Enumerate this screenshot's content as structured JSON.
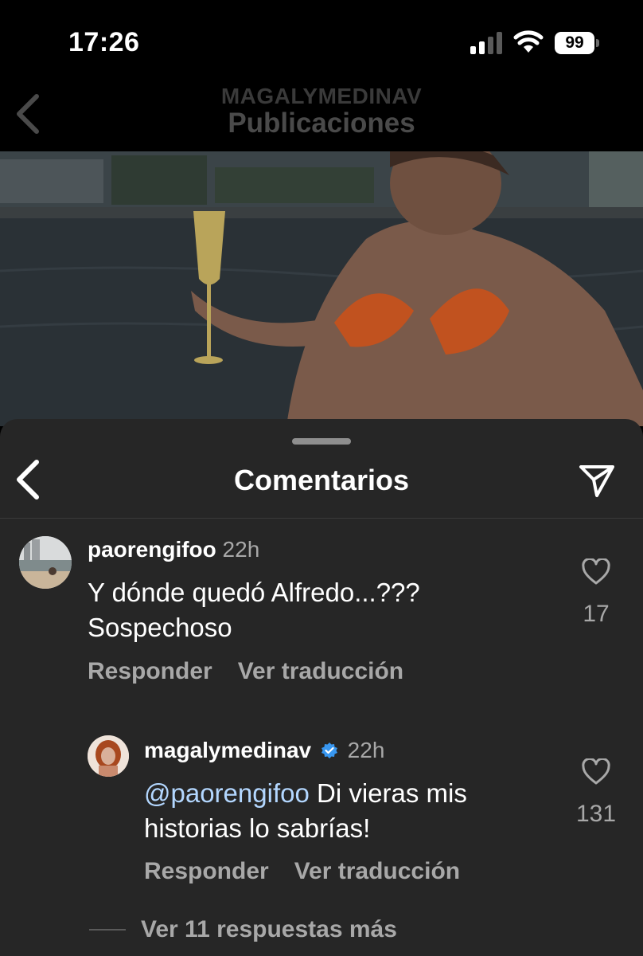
{
  "status_bar": {
    "time": "17:26",
    "battery": "99"
  },
  "header": {
    "username": "MAGALYMEDINAV",
    "title": "Publicaciones"
  },
  "comments_sheet": {
    "title": "Comentarios",
    "comments": [
      {
        "username": "paorengifoo",
        "time": "22h",
        "text_line1": "Y dónde quedó Alfredo...???",
        "text_line2": "Sospechoso",
        "likes": "17",
        "reply_label": "Responder",
        "translate_label": "Ver traducción"
      },
      {
        "username": "magalymedinav",
        "verified": true,
        "time": "22h",
        "mention": "@paorengifoo",
        "text_line1": "Di vieras mis",
        "text_line2": "historias lo sabrías!",
        "likes": "131",
        "reply_label": "Responder",
        "translate_label": "Ver traducción"
      }
    ],
    "more_replies": "Ver 11 respuestas más"
  },
  "colors": {
    "background": "#000000",
    "sheet": "#262626",
    "secondary_text": "#a8a8a8",
    "mention": "#b3d7ff",
    "verified_badge": "#3897f0",
    "bikini": "#c1521f"
  }
}
